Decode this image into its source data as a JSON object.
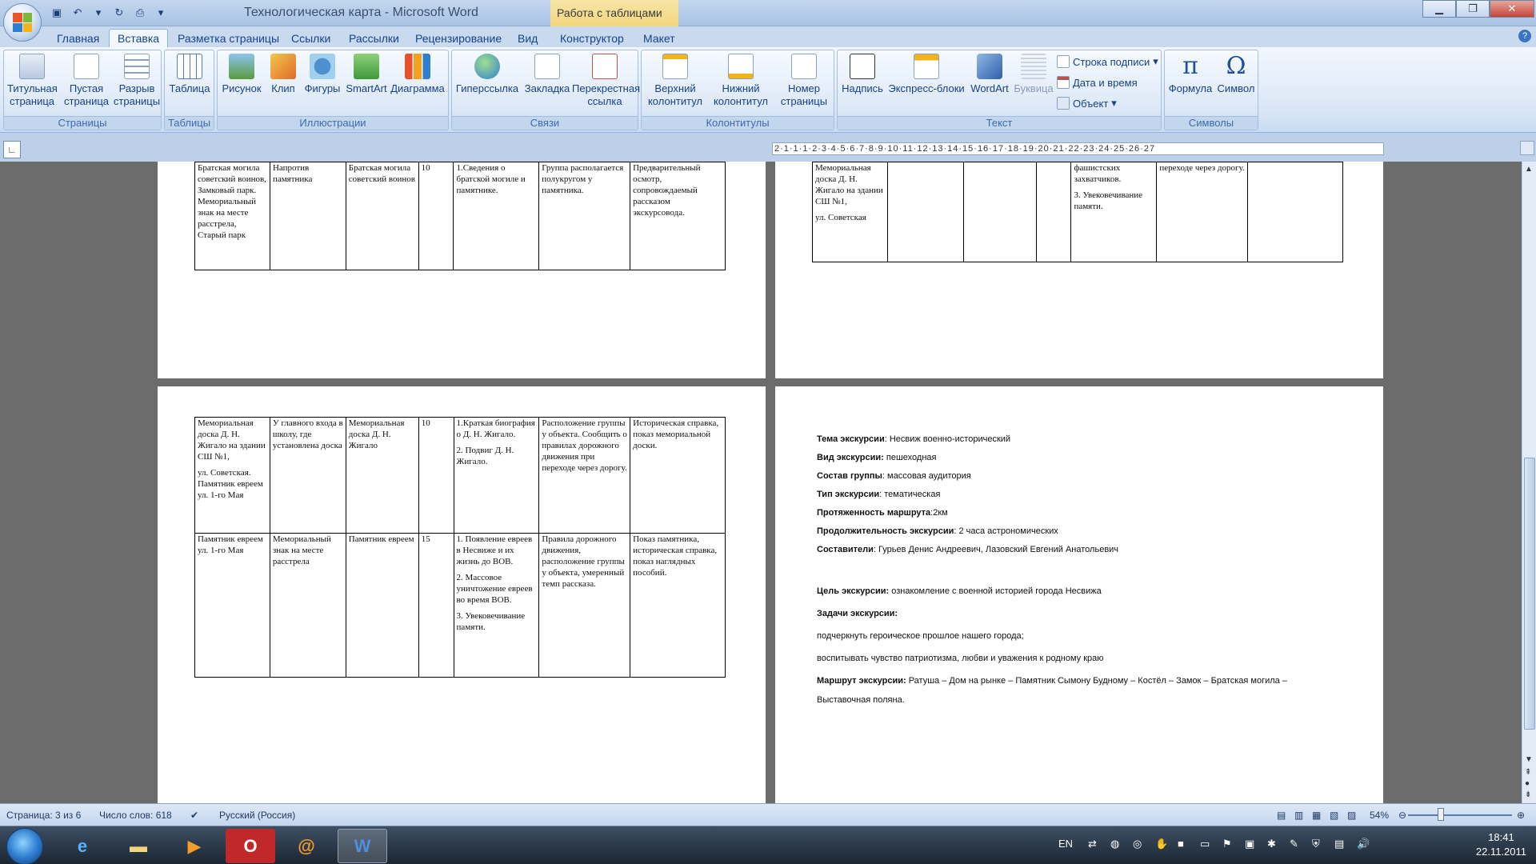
{
  "window": {
    "title": "Технологическая карта - Microsoft Word",
    "context_tab_title": "Работа с таблицами"
  },
  "tabs": [
    "Главная",
    "Вставка",
    "Разметка страницы",
    "Ссылки",
    "Рассылки",
    "Рецензирование",
    "Вид",
    "Конструктор",
    "Макет"
  ],
  "ribbon": {
    "pages": {
      "label": "Страницы",
      "title_page": "Титульная\nстраница",
      "blank_page": "Пустая\nстраница",
      "page_break": "Разрыв\nстраницы"
    },
    "tables": {
      "label": "Таблицы",
      "table": "Таблица"
    },
    "illustrations": {
      "label": "Иллюстрации",
      "picture": "Рисунок",
      "clip": "Клип",
      "shapes": "Фигуры",
      "smartart": "SmartArt",
      "chart": "Диаграмма"
    },
    "links": {
      "label": "Связи",
      "hyperlink": "Гиперссылка",
      "bookmark": "Закладка",
      "cross_ref": "Перекрестная\nссылка"
    },
    "header_footer": {
      "label": "Колонтитулы",
      "header": "Верхний\nколонтитул",
      "footer": "Нижний\nколонтитул",
      "page_number": "Номер\nстраницы"
    },
    "text": {
      "label": "Текст",
      "textbox": "Надпись",
      "quickparts": "Экспресс-блоки",
      "wordart": "WordArt",
      "dropcap": "Буквица",
      "signature": "Строка подписи",
      "datetime": "Дата и время",
      "object": "Объект"
    },
    "symbols": {
      "label": "Символы",
      "equation": "Формула",
      "symbol": "Символ"
    }
  },
  "ruler": {
    "ticks": "2·1·1·1·2·3·4·5·6·7·8·9·10·11·12·13·14·15·16·17·18·19·20·21·22·23·24·25·26·27"
  },
  "page1_table": [
    [
      "Братская могила советский воинов, Замковый парк. Мемориальный знак на месте расстрела, Старый парк",
      "Напротив памятника",
      "Братская могила советский воинов",
      "10",
      "1.Сведения о братской могиле и памятнике.",
      "Группа располагается полукругом у памятника.",
      "Предварительный осмотр, сопровождаемый рассказом экскурсовода."
    ]
  ],
  "page2_table": [
    [
      "Мемориальная доска Д. Н. Жигало на здании СШ №1,",
      "",
      "",
      "",
      "фашистских захватчиков.|3. Увековечивание памяти.",
      "переходе через дорогу.",
      ""
    ]
  ],
  "page2_table_extra": "ул. Советская",
  "page3_table": [
    [
      "Мемориальная доска Д. Н. Жигало на здании СШ №1,|ул. Советская. Памятник евреем ул. 1-го Мая",
      "У главного входа в школу, где установлена доска",
      "Мемориальная доска Д. Н. Жигало",
      "10",
      "1.Краткая биография о Д. Н. Жигало.|2. Подвиг Д. Н. Жигало.",
      "Расположение группы у объекта. Сообщить о правилах дорожного движения при переходе через дорогу.",
      "Историческая справка, показ мемориальной доски."
    ],
    [
      "Памятник евреем ул. 1-го Мая",
      "Мемориальный знак на месте расстрела",
      "Памятник евреем",
      "15",
      "1. Появление евреев в Несвиже и их жизнь до ВОВ.|2. Массовое уничтожение евреев во время ВОВ.|3. Увековечивание памяти.",
      "Правила дорожного движения, расположение группы у объекта, умеренный темп рассказа.",
      "Показ памятника, историческая справка, показ наглядных пособий."
    ]
  ],
  "page4_info": {
    "theme_label": "Тема экскурсии",
    "theme": ": Несвиж военно-исторический",
    "kind_label": "Вид экскурсии:",
    "kind": " пешеходная",
    "group_label": "Состав группы",
    "group": ": массовая аудитория",
    "type_label": "Тип экскурсии",
    "type": ":  тематическая",
    "length_label": "Протяженность маршрута",
    "length": ":2км",
    "duration_label": "Продолжительность экскурсии",
    "duration": ": 2 часа астрономических",
    "authors_label": "Составители",
    "authors": ": Гурьев Денис Андреевич, Лазовский Евгений Анатольевич",
    "goal_label": "Цель экскурсии:",
    "goal": " ознакомление с военной историей города Несвижа",
    "tasks_label": "Задачи экскурсии:",
    "task1": "подчеркнуть героическое прошлое нашего города;",
    "task2": "воспитывать чувство патриотизма, любви и уважения к родному краю",
    "route_label": "Маршрут экскурсии:",
    "route": " Ратуша – Дом на рынке – Памятник Сымону Будному – Костёл – Замок – Братская могила –",
    "route2": "Выставочная поляна."
  },
  "status": {
    "page": "Страница: 3 из 6",
    "words": "Число слов: 618",
    "language": "Русский (Россия)",
    "zoom": "54%"
  },
  "taskbar": {
    "lang": "EN",
    "time": "18:41",
    "date": "22.11.2011"
  }
}
